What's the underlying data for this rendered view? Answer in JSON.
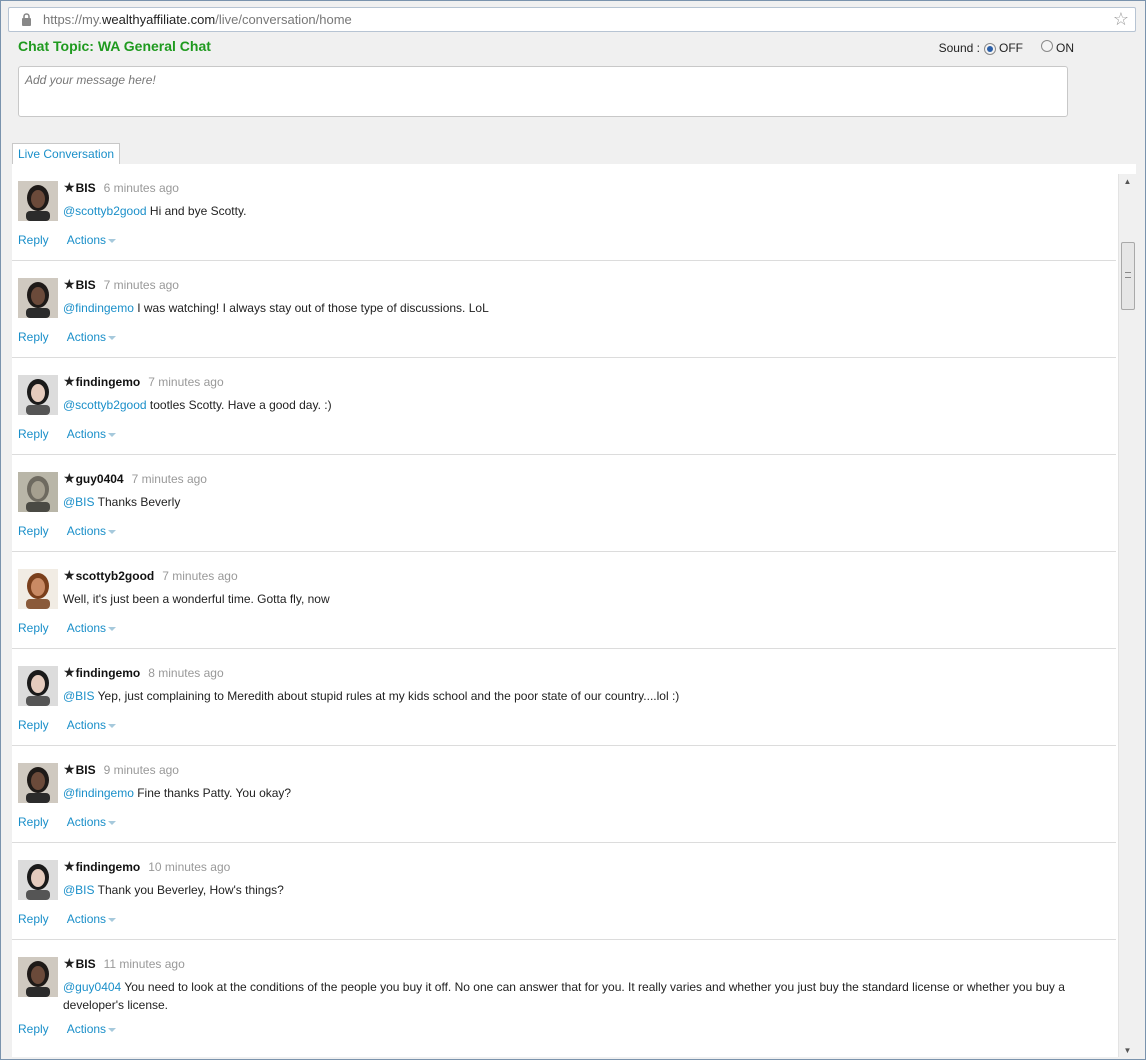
{
  "browser": {
    "url_prefix": "https://my.",
    "url_host": "wealthyaffiliate.com",
    "url_path": "/live/conversation/home"
  },
  "chat": {
    "topic": "Chat Topic: WA General Chat",
    "sound_label": "Sound :",
    "sound_off": "OFF",
    "sound_on": "ON",
    "sound_selected": "OFF",
    "input_placeholder": "Add your message here!",
    "tab_label": "Live Conversation"
  },
  "labels": {
    "reply": "Reply",
    "actions": "Actions",
    "star": "★"
  },
  "messages": [
    {
      "user": "BIS",
      "time": "6 minutes ago",
      "mention": "@scottyb2good",
      "text": " Hi and bye Scotty.",
      "avatar": "dark-hair"
    },
    {
      "user": "BIS",
      "time": "7 minutes ago",
      "mention": "@findingemo",
      "text": " I was watching! I always stay out of those type of discussions. LoL",
      "avatar": "dark-hair"
    },
    {
      "user": "findingemo",
      "time": "7 minutes ago",
      "mention": "@scottyb2good",
      "text": " tootles Scotty. Have a good day. :)",
      "avatar": "long-hair"
    },
    {
      "user": "guy0404",
      "time": "7 minutes ago",
      "mention": "@BIS",
      "text": " Thanks Beverly",
      "avatar": "outdoor"
    },
    {
      "user": "scottyb2good",
      "time": "7 minutes ago",
      "mention": "",
      "text": "Well, it's just been a wonderful time. Gotta fly, now",
      "avatar": "brown-hair"
    },
    {
      "user": "findingemo",
      "time": "8 minutes ago",
      "mention": "@BIS",
      "text": " Yep, just complaining to Meredith about stupid rules at my kids school and the poor state of our country....lol :)",
      "avatar": "long-hair"
    },
    {
      "user": "BIS",
      "time": "9 minutes ago",
      "mention": "@findingemo",
      "text": " Fine thanks Patty. You okay?",
      "avatar": "dark-hair"
    },
    {
      "user": "findingemo",
      "time": "10 minutes ago",
      "mention": "@BIS",
      "text": " Thank you Beverley, How's things?",
      "avatar": "long-hair"
    },
    {
      "user": "BIS",
      "time": "11 minutes ago",
      "mention": "@guy0404",
      "text": " You need to look at the conditions of the people you buy it off. No one can answer that for you. It really varies and whether you just buy the standard license or whether you buy a developer's license.",
      "avatar": "dark-hair"
    }
  ],
  "colors": {
    "topic": "#1f9a1f",
    "link": "#1a8fc9",
    "time": "#999999"
  }
}
